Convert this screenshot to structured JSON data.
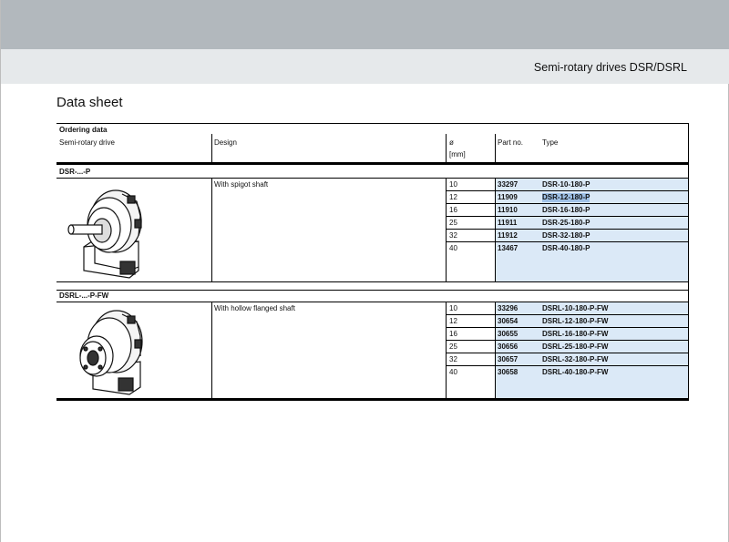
{
  "header": {
    "title": "Semi-rotary drives DSR/DSRL"
  },
  "page": {
    "heading": "Data sheet"
  },
  "table": {
    "section_title": "Ordering data",
    "columns": {
      "product": "Semi-rotary drive",
      "design": "Design",
      "diameter_symbol": "ø",
      "diameter_unit": "[mm]",
      "part_no": "Part no.",
      "type": "Type"
    },
    "groups": [
      {
        "name": "DSR-...-P",
        "design": "With spigot shaft",
        "image_icon": "semi-rotary-drive-spigot-shaft-icon",
        "rows": [
          {
            "dia": "10",
            "part": "33297",
            "type": "DSR-10-180-P"
          },
          {
            "dia": "12",
            "part": "11909",
            "type": "DSR-12-180-P"
          },
          {
            "dia": "16",
            "part": "11910",
            "type": "DSR-16-180-P"
          },
          {
            "dia": "25",
            "part": "11911",
            "type": "DSR-25-180-P"
          },
          {
            "dia": "32",
            "part": "11912",
            "type": "DSR-32-180-P"
          },
          {
            "dia": "40",
            "part": "13467",
            "type": "DSR-40-180-P"
          }
        ]
      },
      {
        "name": "DSRL-...-P-FW",
        "design": "With hollow flanged shaft",
        "image_icon": "semi-rotary-drive-hollow-flanged-shaft-icon",
        "rows": [
          {
            "dia": "10",
            "part": "33296",
            "type": "DSRL-10-180-P-FW"
          },
          {
            "dia": "12",
            "part": "30654",
            "type": "DSRL-12-180-P-FW"
          },
          {
            "dia": "16",
            "part": "30655",
            "type": "DSRL-16-180-P-FW"
          },
          {
            "dia": "25",
            "part": "30656",
            "type": "DSRL-25-180-P-FW"
          },
          {
            "dia": "32",
            "part": "30657",
            "type": "DSRL-32-180-P-FW"
          },
          {
            "dia": "40",
            "part": "30658",
            "type": "DSRL-40-180-P-FW"
          }
        ]
      }
    ]
  },
  "colors": {
    "highlight": "#dbe9f7",
    "selection": "#9fc1e7",
    "topbar": "#b2b8bd",
    "header_band": "#e6e9eb"
  }
}
